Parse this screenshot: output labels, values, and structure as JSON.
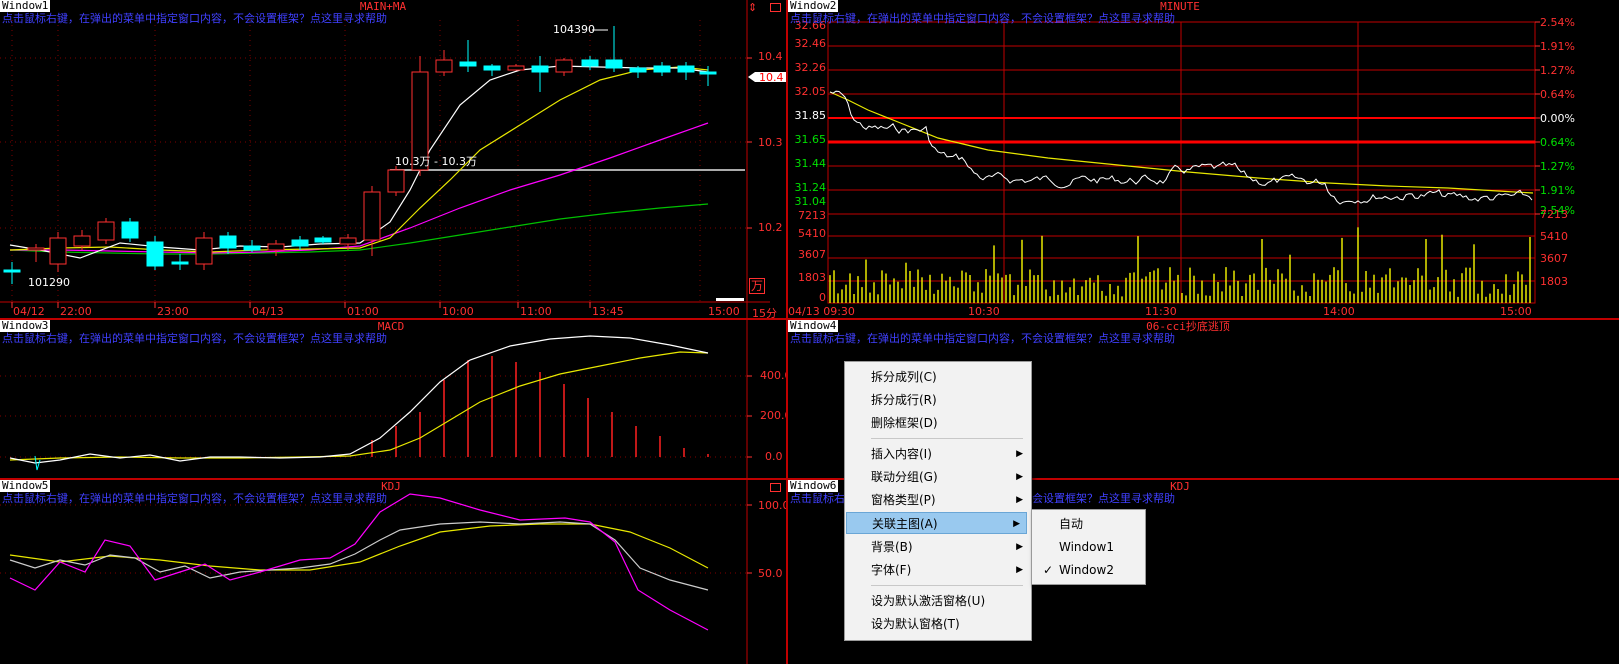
{
  "hint_text": "点击鼠标右键，在弹出的菜单中指定窗口内容，不会设置框架？点这里寻求帮助",
  "windows": {
    "w1": {
      "tag": "Window1",
      "title": "MAIN+MA"
    },
    "w2": {
      "tag": "Window2",
      "title": "MINUTE"
    },
    "w3": {
      "tag": "Window3",
      "title": "MACD"
    },
    "w4": {
      "tag": "Window4",
      "title": "06-cci抄底逃顶"
    },
    "w5": {
      "tag": "Window5",
      "title": "KDJ"
    },
    "w6": {
      "tag": "Window6",
      "title": "KDJ"
    }
  },
  "w1": {
    "price_labels": [
      "10.4",
      "10.3",
      "10.2"
    ],
    "current_price": "10.4",
    "high_label": "104390",
    "low_label": "101290",
    "hline_label": "10.3万 - 10.3万",
    "x_labels": [
      "04/12",
      "22:00",
      "23:00",
      "04/13",
      "01:00",
      "10:00",
      "11:00",
      "13:45",
      "15:00"
    ],
    "period_label": "15分",
    "unit_label": "万",
    "arrow_label": "⇕"
  },
  "w2": {
    "left_labels": [
      "32.66",
      "32.46",
      "32.26",
      "32.05",
      "31.85",
      "31.65",
      "31.44",
      "31.24",
      "31.04",
      "7213",
      "5410",
      "3607",
      "1803",
      "0"
    ],
    "right_labels": [
      "2.54%",
      "1.91%",
      "1.27%",
      "0.64%",
      "0.00%",
      "0.64%",
      "1.27%",
      "1.91%",
      "2.54%",
      "7213",
      "5410",
      "3607",
      "1803"
    ],
    "x_labels": [
      "04/13 09:30",
      "10:30",
      "11:30",
      "14:00",
      "15:00"
    ]
  },
  "w3": {
    "y_labels": [
      "400.0",
      "200.0",
      "0.0"
    ]
  },
  "w5": {
    "y_labels": [
      "100.0",
      "50.0"
    ]
  },
  "context_menu": {
    "items": [
      {
        "label": "拆分成列(C)",
        "submenu": false
      },
      {
        "label": "拆分成行(R)",
        "submenu": false
      },
      {
        "label": "删除框架(D)",
        "submenu": false
      },
      {
        "label": "插入内容(I)",
        "submenu": true
      },
      {
        "label": "联动分组(G)",
        "submenu": true
      },
      {
        "label": "窗格类型(P)",
        "submenu": true
      },
      {
        "label": "关联主图(A)",
        "submenu": true,
        "selected": true
      },
      {
        "label": "背景(B)",
        "submenu": true
      },
      {
        "label": "字体(F)",
        "submenu": true
      },
      {
        "label": "设为默认激活窗格(U)",
        "submenu": false
      },
      {
        "label": "设为默认窗格(T)",
        "submenu": false
      }
    ],
    "submenu": [
      {
        "label": "自动",
        "checked": false
      },
      {
        "label": "Window1",
        "checked": false
      },
      {
        "label": "Window2",
        "checked": true
      }
    ]
  },
  "colors": {
    "grid": "#c00000",
    "axis_text_red": "#ff3030",
    "axis_text_green": "#00e000",
    "hint_blue": "#4040ff",
    "white_line": "#ffffff",
    "yellow_line": "#e8e800",
    "magenta_line": "#ff00ff",
    "green_line": "#00c000",
    "candle_up": "#ff3030",
    "candle_down": "#00ffff"
  }
}
